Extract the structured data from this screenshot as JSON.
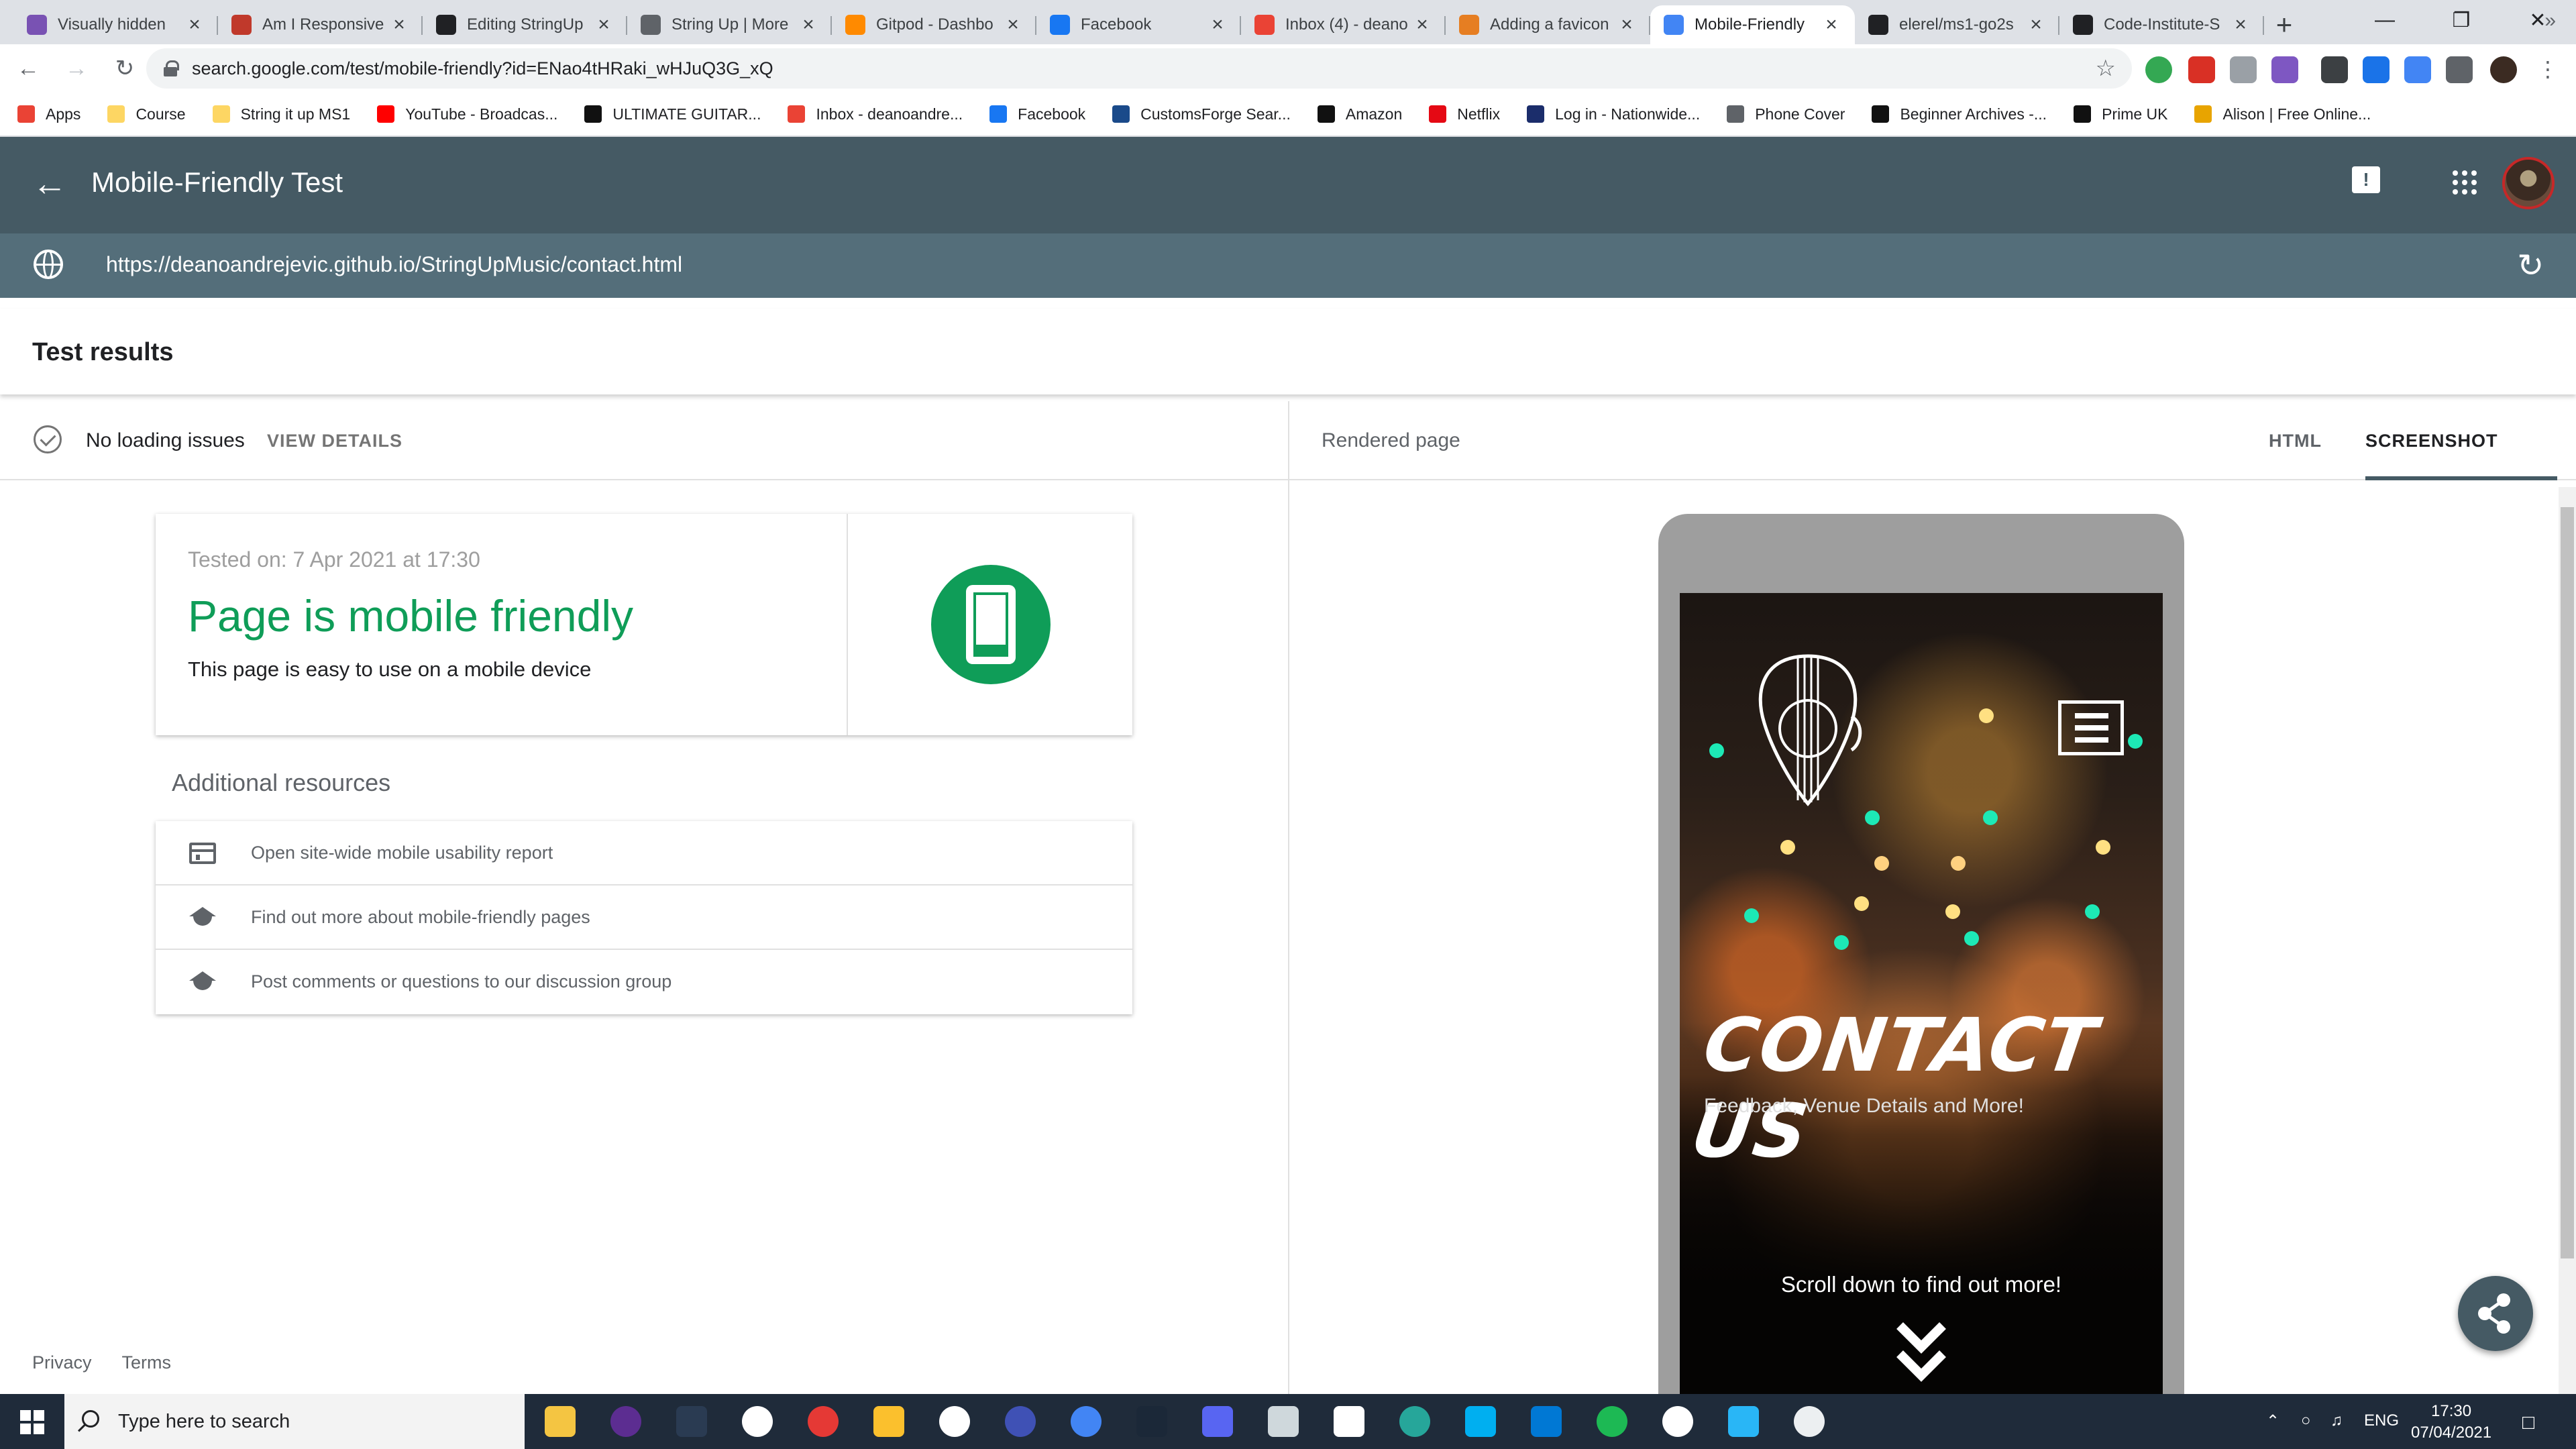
{
  "browser": {
    "tabs": [
      {
        "title": "Visually hidden",
        "icon": "bootstrap-icon",
        "color": "#7952b3",
        "active": false
      },
      {
        "title": "Am I Responsive",
        "icon": "amiresponsive-icon",
        "color": "#c0392b",
        "active": false
      },
      {
        "title": "Editing StringUp",
        "icon": "github-icon",
        "color": "#202124",
        "active": false
      },
      {
        "title": "String Up | More",
        "icon": "globe-icon",
        "color": "#5f6368",
        "active": false
      },
      {
        "title": "Gitpod - Dashbo",
        "icon": "gitpod-icon",
        "color": "#ff8a00",
        "active": false
      },
      {
        "title": "Facebook",
        "icon": "facebook-icon",
        "color": "#1877f2",
        "active": false
      },
      {
        "title": "Inbox (4) - deano",
        "icon": "gmail-icon",
        "color": "#ea4335",
        "active": false
      },
      {
        "title": "Adding a favicon",
        "icon": "blog-icon",
        "color": "#e67e22",
        "active": false
      },
      {
        "title": "Mobile-Friendly",
        "icon": "search-console-icon",
        "color": "#4285f4",
        "active": true
      },
      {
        "title": "elerel/ms1-go2s",
        "icon": "github-icon",
        "color": "#202124",
        "active": false
      },
      {
        "title": "Code-Institute-S",
        "icon": "github-icon",
        "color": "#202124",
        "active": false
      }
    ],
    "url": "search.google.com/test/mobile-friendly?id=ENao4tHRaki_wHJuQ3G_xQ",
    "bookmarks": [
      {
        "label": "Apps",
        "color": "#ea4335"
      },
      {
        "label": "Course",
        "color": "#fdd663"
      },
      {
        "label": "String it up MS1",
        "color": "#fdd663"
      },
      {
        "label": "YouTube - Broadcas...",
        "color": "#ff0000"
      },
      {
        "label": "ULTIMATE GUITAR...",
        "color": "#111111"
      },
      {
        "label": "Inbox - deanoandre...",
        "color": "#ea4335"
      },
      {
        "label": "Facebook",
        "color": "#1877f2"
      },
      {
        "label": "CustomsForge Sear...",
        "color": "#1a4a8a"
      },
      {
        "label": "Amazon",
        "color": "#111111"
      },
      {
        "label": "Netflix",
        "color": "#e50914"
      },
      {
        "label": "Log in - Nationwide...",
        "color": "#1b2d6b"
      },
      {
        "label": "Phone Cover",
        "color": "#5f6368"
      },
      {
        "label": "Beginner Archives -...",
        "color": "#111111"
      },
      {
        "label": "Prime UK",
        "color": "#111111"
      },
      {
        "label": "Alison | Free Online...",
        "color": "#e8a400"
      }
    ]
  },
  "app": {
    "title": "Mobile-Friendly Test",
    "tested_url": "https://deanoandrejevic.github.io/StringUpMusic/contact.html",
    "results_title": "Test results",
    "status": {
      "text": "No loading issues",
      "link": "VIEW DETAILS"
    },
    "rendered_page_label": "Rendered page",
    "tabs": {
      "html": "HTML",
      "screenshot": "SCREENSHOT"
    },
    "card": {
      "tested_on": "Tested on: 7 Apr 2021 at 17:30",
      "headline": "Page is mobile friendly",
      "subtext": "This page is easy to use on a mobile device"
    },
    "additional_title": "Additional resources",
    "resources": [
      {
        "label": "Open site-wide mobile usability report",
        "icon": "report-icon"
      },
      {
        "label": "Find out more about mobile-friendly pages",
        "icon": "school-icon"
      },
      {
        "label": "Post comments or questions to our discussion group",
        "icon": "school-icon"
      }
    ],
    "footer": {
      "privacy": "Privacy",
      "terms": "Terms"
    },
    "accent": "#0f9d58",
    "header_color": "#455a64"
  },
  "preview": {
    "title": "CONTACT US",
    "subtitle": "Feedback, Venue Details and More!",
    "scroll_text": "Scroll down to find out more!"
  },
  "taskbar": {
    "search_placeholder": "Type here to search",
    "language": "ENG",
    "time": "17:30",
    "date": "07/04/2021"
  }
}
